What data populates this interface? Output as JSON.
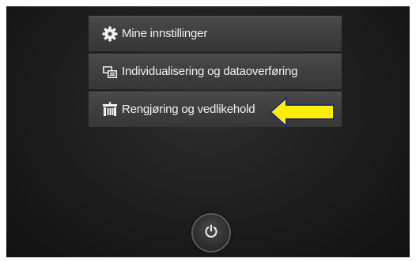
{
  "menu": {
    "items": [
      {
        "label": "Mine innstillinger",
        "icon": "gear-icon"
      },
      {
        "label": "Individualisering og dataoverføring",
        "icon": "data-transfer-icon"
      },
      {
        "label": "Rengjøring og vedlikehold",
        "icon": "maintenance-icon"
      }
    ]
  },
  "annotation": {
    "arrow_color": "#ffee00",
    "arrow_outline": "#1e2a78",
    "points_to": "Rengjøring og vedlikehold"
  },
  "power": {
    "icon": "power-icon"
  },
  "colors": {
    "menu_bg": "#404040",
    "text": "#f2f2f2",
    "screen_bg": "#1d1d1d"
  }
}
